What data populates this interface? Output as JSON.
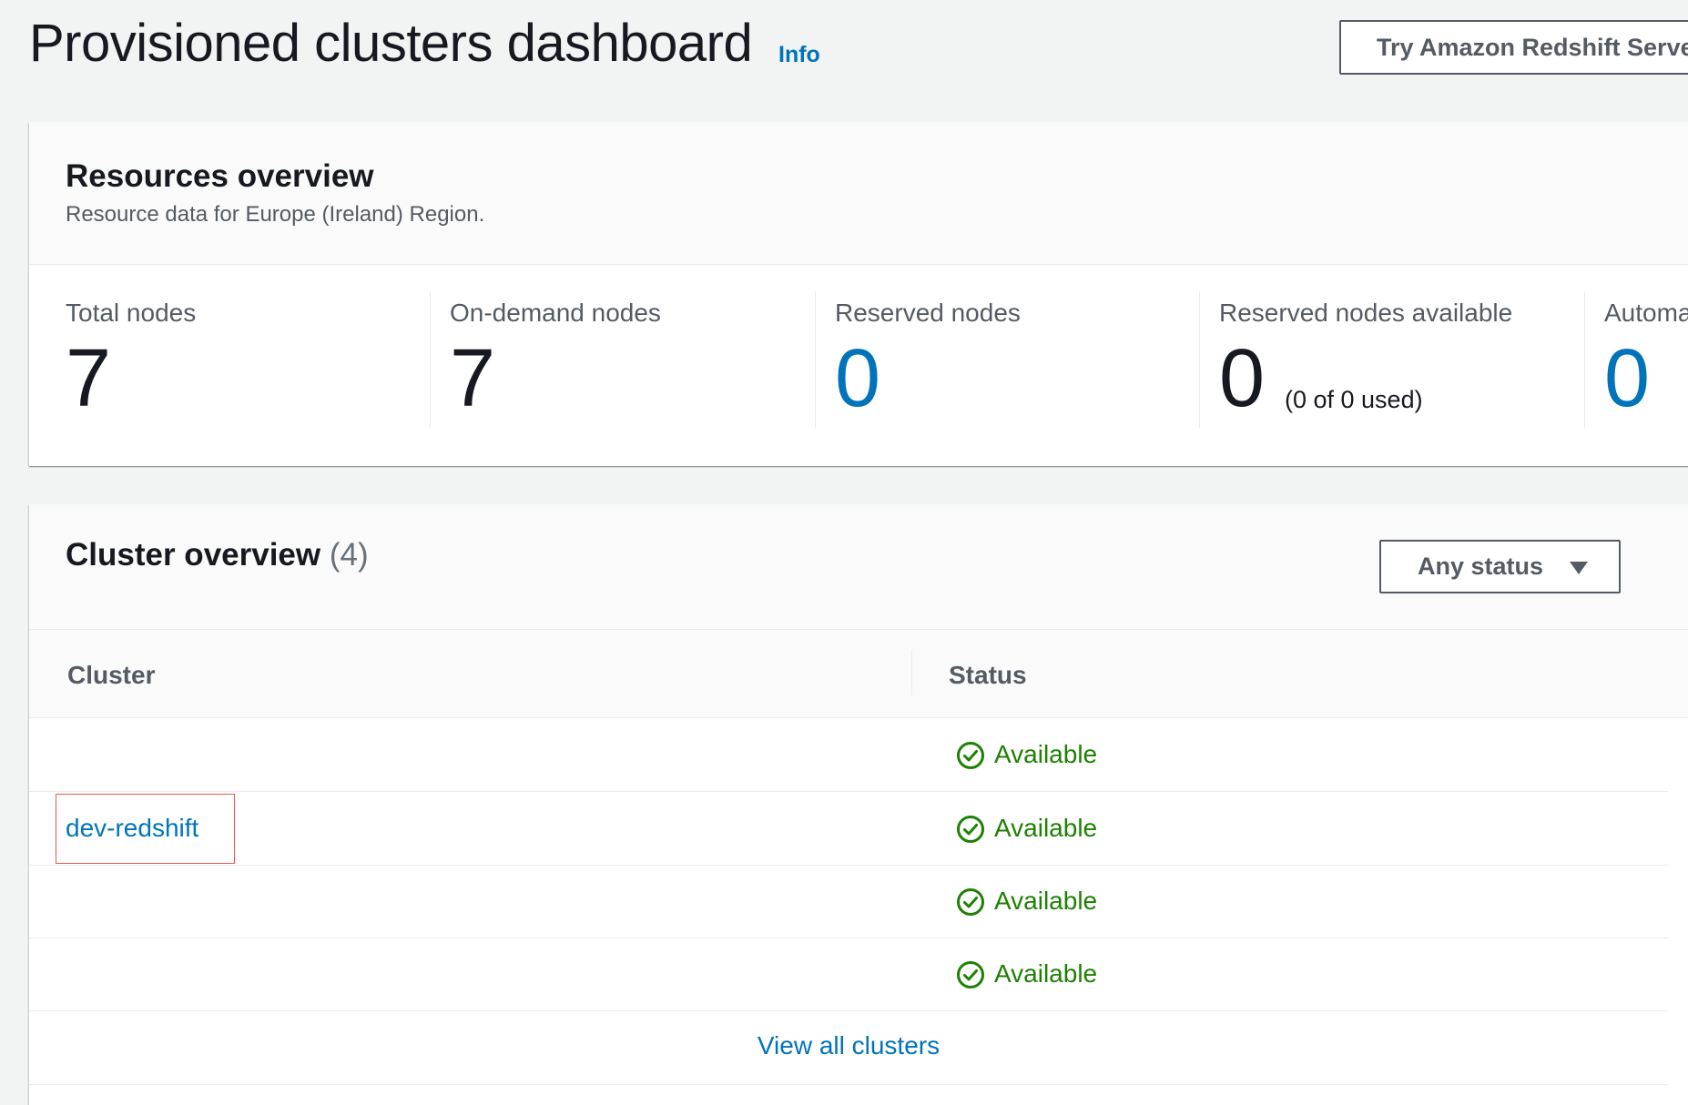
{
  "header": {
    "title": "Provisioned clusters dashboard",
    "info_label": "Info",
    "try_button_label": "Try Amazon Redshift Serverless"
  },
  "resources": {
    "title": "Resources overview",
    "description": "Resource data for Europe (Ireland) Region.",
    "metrics": [
      {
        "label": "Total nodes",
        "value": "7"
      },
      {
        "label": "On-demand nodes",
        "value": "7"
      },
      {
        "label": "Reserved nodes",
        "value": "0"
      },
      {
        "label": "Reserved nodes available",
        "value": "0",
        "sub": "(0 of 0 used)"
      },
      {
        "label": "Automated snapshots",
        "value": "0"
      }
    ]
  },
  "clusters": {
    "title": "Cluster overview",
    "count": "(4)",
    "filter_label": "Any status",
    "columns": {
      "cluster": "Cluster",
      "status": "Status"
    },
    "rows": [
      {
        "cluster": "",
        "status": "Available"
      },
      {
        "cluster": "dev-redshift",
        "status": "Available"
      },
      {
        "cluster": "",
        "status": "Available"
      },
      {
        "cluster": "",
        "status": "Available"
      }
    ],
    "view_all_label": "View all clusters"
  },
  "colors": {
    "link": "#0073bb",
    "success": "#1d8102",
    "highlight": "#e8584f"
  }
}
